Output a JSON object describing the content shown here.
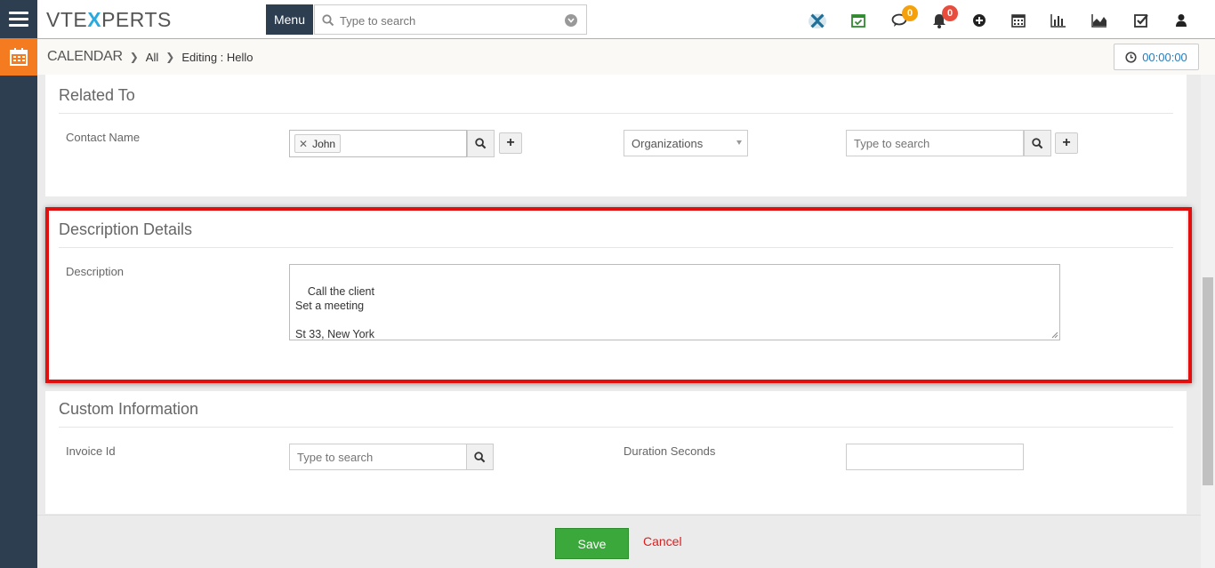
{
  "app": {
    "logo_prefix": "VTE",
    "logo_x": "X",
    "logo_suffix": "PERTS",
    "menu_label": "Menu",
    "search_placeholder": "Type to search"
  },
  "notifications": {
    "chat_count": "0",
    "bell_count": "0"
  },
  "breadcrumb": {
    "module": "CALENDAR",
    "all": "All",
    "current": "Editing : Hello"
  },
  "timer": {
    "value": "00:00:00"
  },
  "related_to": {
    "title": "Related To",
    "contact_label": "Contact Name",
    "contact_tag": "John",
    "org_select": "Organizations",
    "org_search_placeholder": "Type to search"
  },
  "description_details": {
    "title": "Description Details",
    "description_label": "Description",
    "description_value": "Call the client\nSet a meeting\n\nSt 33, New York"
  },
  "custom_information": {
    "title": "Custom Information",
    "invoice_label": "Invoice Id",
    "invoice_placeholder": "Type to search",
    "duration_label": "Duration Seconds",
    "duration_value": ""
  },
  "actions": {
    "save_label": "Save",
    "cancel_label": "Cancel"
  },
  "colors": {
    "rail": "#2c3e50",
    "accent_orange": "#f47b20",
    "save_green": "#3aa83a",
    "cancel_red": "#e31b1b",
    "highlight_red": "#e30f0f"
  },
  "icons": [
    "hamburger-icon",
    "calendar-icon",
    "search-icon",
    "chevron-down-icon",
    "vtiger-x-icon",
    "task-calendar-icon",
    "chat-icon",
    "bell-icon",
    "plus-circle-icon",
    "calendar-grid-icon",
    "bar-chart-icon",
    "area-chart-icon",
    "checkbox-icon",
    "user-icon",
    "clock-icon",
    "close-icon",
    "plus-icon"
  ]
}
